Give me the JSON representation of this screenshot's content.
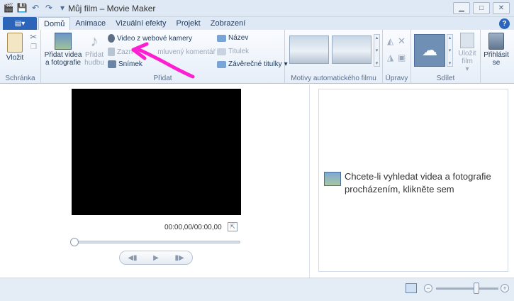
{
  "titlebar": {
    "title": "Můj film – Movie Maker"
  },
  "tabs": {
    "file_label": "▤▾",
    "items": [
      "Domů",
      "Animace",
      "Vizuální efekty",
      "Projekt",
      "Zobrazení"
    ]
  },
  "ribbon": {
    "clipboard": {
      "paste_label": "Vložit",
      "group_label": "Schránka"
    },
    "add": {
      "add_video_label": "Přidat videa a fotografie",
      "add_music_label": "Přidat hudbu",
      "webcam_label": "Video z webové kamery",
      "record_label_prefix": "Zazn",
      "narration_label": "mluvený komentář",
      "snapshot_label": "Snímek",
      "title_label": "Název",
      "caption_label": "Titulek",
      "credits_label": "Závěrečné titulky",
      "group_label": "Přidat"
    },
    "themes": {
      "group_label": "Motivy automatického filmu"
    },
    "edit": {
      "group_label": "Úpravy"
    },
    "share": {
      "group_label": "Sdílet",
      "save_movie_label": "Uložit film",
      "signin_label": "Přihlásit se"
    }
  },
  "preview": {
    "timecode": "00:00,00/00:00,00"
  },
  "storyboard": {
    "hint": "Chcete-li vyhledat videa a fotografie procházením, klikněte sem"
  },
  "colors": {
    "accent": "#2b64b8",
    "annotation": "#ff1fd2"
  }
}
